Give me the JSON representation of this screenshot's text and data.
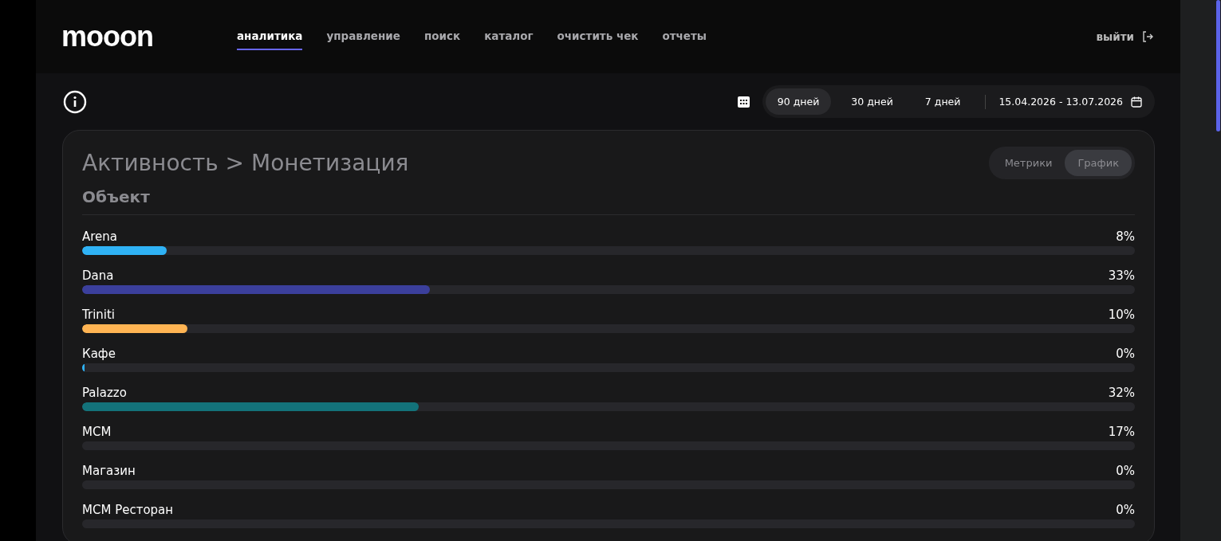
{
  "logo": "mooon",
  "nav": [
    {
      "label": "аналитика",
      "selected": true
    },
    {
      "label": "управление",
      "selected": false
    },
    {
      "label": "поиск",
      "selected": false
    },
    {
      "label": "каталог",
      "selected": false
    },
    {
      "label": "очистить чек",
      "selected": false
    },
    {
      "label": "отчеты",
      "selected": false
    }
  ],
  "logout": "выйти",
  "periods": [
    {
      "label": "90 дней",
      "selected": true
    },
    {
      "label": "30 дней",
      "selected": false
    },
    {
      "label": "7 дней",
      "selected": false
    }
  ],
  "date_range": "15.04.2026 - 13.07.2026",
  "card": {
    "title": "Активность > Монетизация",
    "subtitle": "Объект",
    "view_toggle": [
      {
        "label": "Метрики",
        "selected": false
      },
      {
        "label": "График",
        "selected": true
      }
    ],
    "rows": [
      {
        "name": "Arena",
        "percent": "8%",
        "level": 0.08,
        "color": "#2fb2f5"
      },
      {
        "name": "Dana",
        "percent": "33%",
        "level": 0.33,
        "color": "#3b3f9c"
      },
      {
        "name": "Triniti",
        "percent": "10%",
        "level": 0.1,
        "color": "#ffb453"
      },
      {
        "name": "Кафе",
        "percent": "0%",
        "level": 0.002,
        "color": "#2fb2f5"
      },
      {
        "name": "Palazzo",
        "percent": "32%",
        "level": 0.32,
        "color": "#13727a"
      },
      {
        "name": "MCM",
        "percent": "17%"
      },
      {
        "name": "Магазин",
        "percent": "0%"
      },
      {
        "name": "MCM Ресторан",
        "percent": "0%"
      }
    ]
  }
}
